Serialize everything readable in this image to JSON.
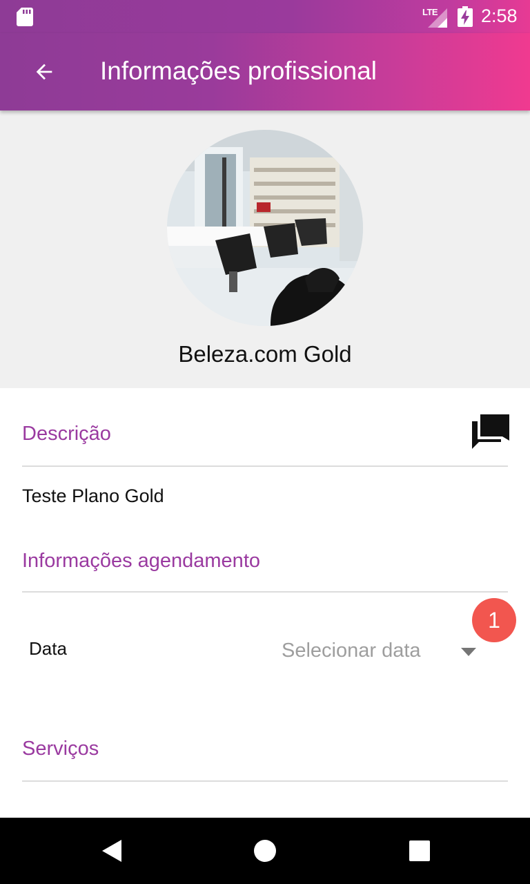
{
  "status_bar": {
    "network": "LTE",
    "time": "2:58",
    "icons": [
      "sd-card-icon",
      "lte-signal-icon",
      "battery-charging-icon"
    ]
  },
  "app_bar": {
    "title": "Informações profissional",
    "back_icon": "arrow-back-icon"
  },
  "profile": {
    "name": "Beleza.com Gold",
    "avatar": "salon-photo"
  },
  "sections": {
    "description": {
      "title": "Descrição",
      "text": "Teste Plano Gold",
      "action_icon": "chat-icon"
    },
    "scheduling": {
      "title": "Informações agendamento",
      "date_label": "Data",
      "date_placeholder": "Selecionar data",
      "badge_count": "1"
    },
    "services": {
      "title": "Serviços"
    }
  },
  "colors": {
    "accent": "#9a3aa0",
    "gradient_start": "#8e3b96",
    "gradient_end": "#f03a90",
    "badge": "#f2564f"
  },
  "nav_bar": {
    "icons": [
      "nav-back-icon",
      "nav-home-icon",
      "nav-recents-icon"
    ]
  }
}
